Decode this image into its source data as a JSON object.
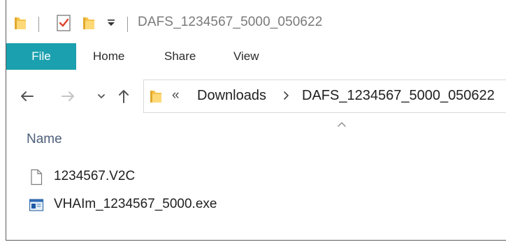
{
  "window": {
    "title": "DAFS_1234567_5000_050622"
  },
  "ribbon": {
    "tabs": [
      {
        "label": "File",
        "active": true
      },
      {
        "label": "Home"
      },
      {
        "label": "Share"
      },
      {
        "label": "View"
      }
    ]
  },
  "address_bar": {
    "overflow": "«",
    "breadcrumbs": [
      "Downloads",
      "DAFS_1234567_5000_050622"
    ]
  },
  "list": {
    "column_header": "Name",
    "items": [
      {
        "name": "1234567.V2C",
        "icon": "blank-file-icon"
      },
      {
        "name": "VHAIm_1234567_5000.exe",
        "icon": "exe-app-icon"
      }
    ]
  },
  "colors": {
    "file_tab": "#1aa0ae",
    "folder": "#f6c34a",
    "header_text": "#4c5f7a"
  }
}
